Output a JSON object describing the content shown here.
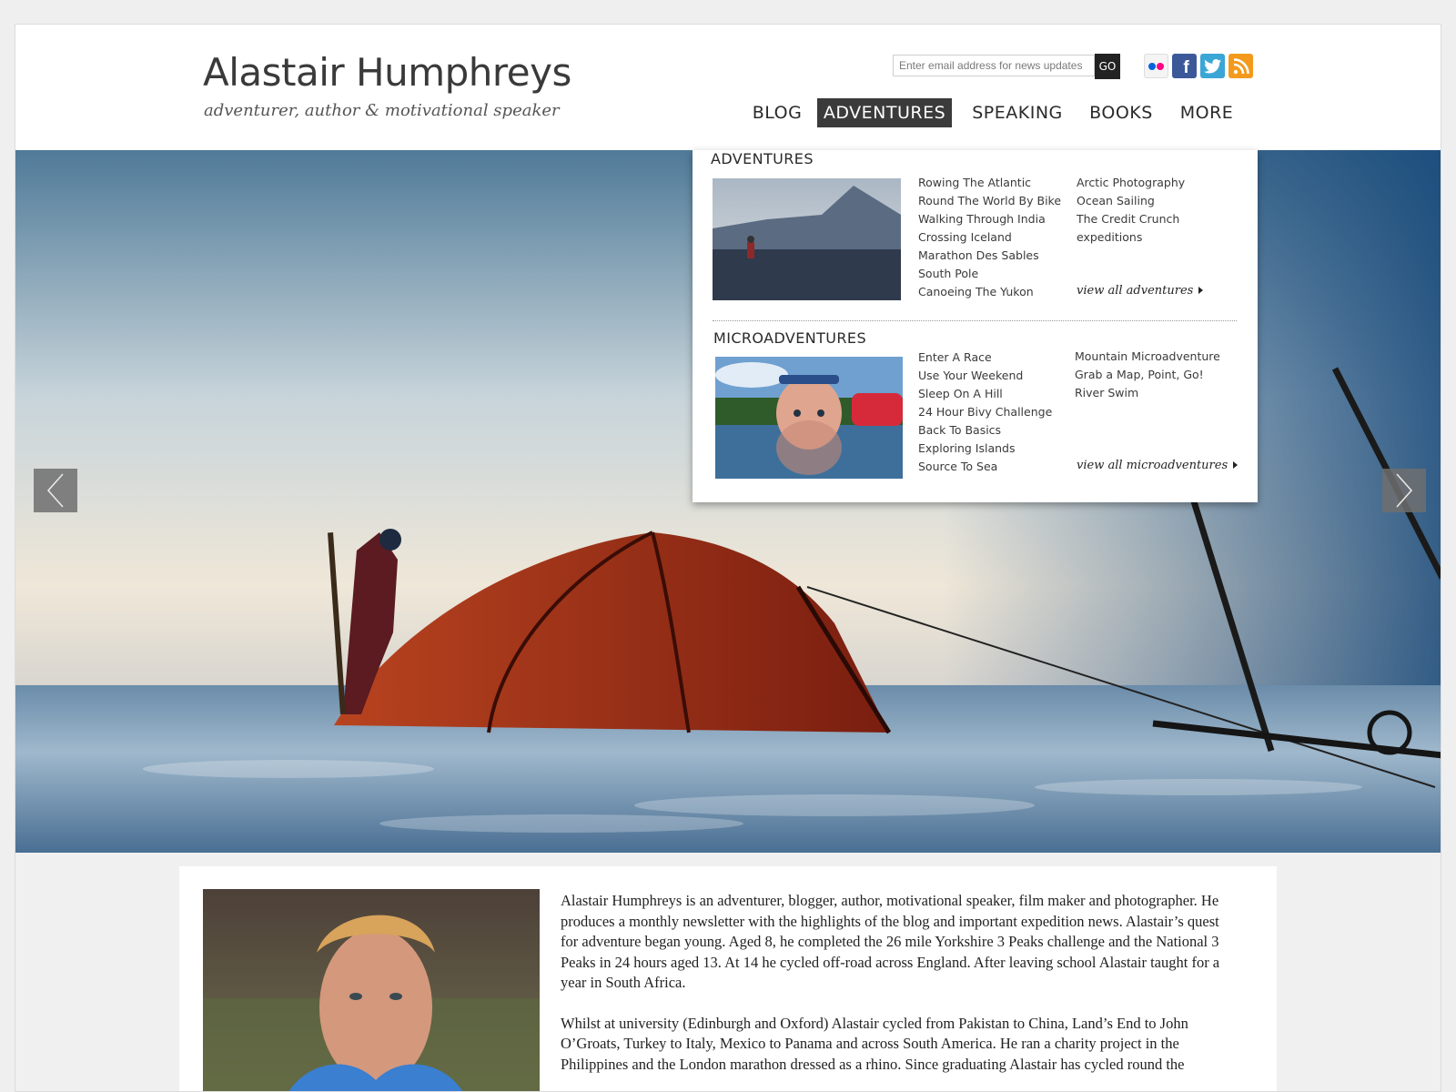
{
  "header": {
    "title": "Alastair Humphreys",
    "tagline": "adventurer, author & motivational speaker",
    "newsletter": {
      "placeholder": "Enter email address for news updates",
      "button_label": "GO"
    },
    "social": [
      {
        "name": "flickr",
        "icon": "flickr-icon"
      },
      {
        "name": "facebook",
        "icon": "facebook-icon",
        "glyph": "f"
      },
      {
        "name": "twitter",
        "icon": "twitter-icon"
      },
      {
        "name": "rss",
        "icon": "rss-icon"
      }
    ]
  },
  "nav": {
    "items": [
      {
        "label": "BLOG"
      },
      {
        "label": "ADVENTURES",
        "active": true
      },
      {
        "label": "SPEAKING"
      },
      {
        "label": "BOOKS"
      },
      {
        "label": "MORE"
      }
    ]
  },
  "dropdown": {
    "adventures": {
      "heading": "ADVENTURES",
      "col1": [
        "Rowing The Atlantic",
        "Round The World By Bike",
        "Walking Through India",
        "Crossing Iceland",
        "Marathon Des Sables",
        "South Pole",
        "Canoeing The Yukon"
      ],
      "col2": [
        "Arctic Photography",
        "Ocean Sailing",
        "The Credit Crunch",
        "expeditions"
      ],
      "view_all": "view all adventures"
    },
    "microadventures": {
      "heading": "MICROADVENTURES",
      "col1": [
        "Enter A Race",
        "Use Your Weekend",
        "Sleep On A Hill",
        "24 Hour Bivy Challenge",
        "Back To Basics",
        "Exploring Islands",
        "Source To Sea"
      ],
      "col2": [
        "Mountain Microadventure",
        "Grab a Map, Point, Go!",
        "River Swim"
      ],
      "view_all": "view all microadventures"
    }
  },
  "slider": {
    "prev_icon": "chevron-left-icon",
    "next_icon": "chevron-right-icon"
  },
  "bio": {
    "paragraphs": [
      "Alastair Humphreys is an adventurer, blogger, author, motivational speaker, film maker and photographer. He produces a monthly newsletter with the highlights of the blog and important expedition news. Alastair’s quest for adventure began young. Aged 8, he completed the 26 mile Yorkshire 3 Peaks challenge and the National 3 Peaks in 24 hours aged 13. At 14 he cycled off-road across England. After leaving school Alastair taught for a year in South Africa.",
      "Whilst at university (Edinburgh and Oxford) Alastair cycled from Pakistan to China, Land’s End to John O’Groats, Turkey to Italy, Mexico to Panama and across South America. He ran a charity project in the Philippines and the London marathon dressed as a rhino. Since graduating Alastair has cycled round the"
    ]
  },
  "colors": {
    "nav_active_bg": "#3b3b3b",
    "tent": "#a8331c",
    "sky_top": "#5f8aa8"
  }
}
